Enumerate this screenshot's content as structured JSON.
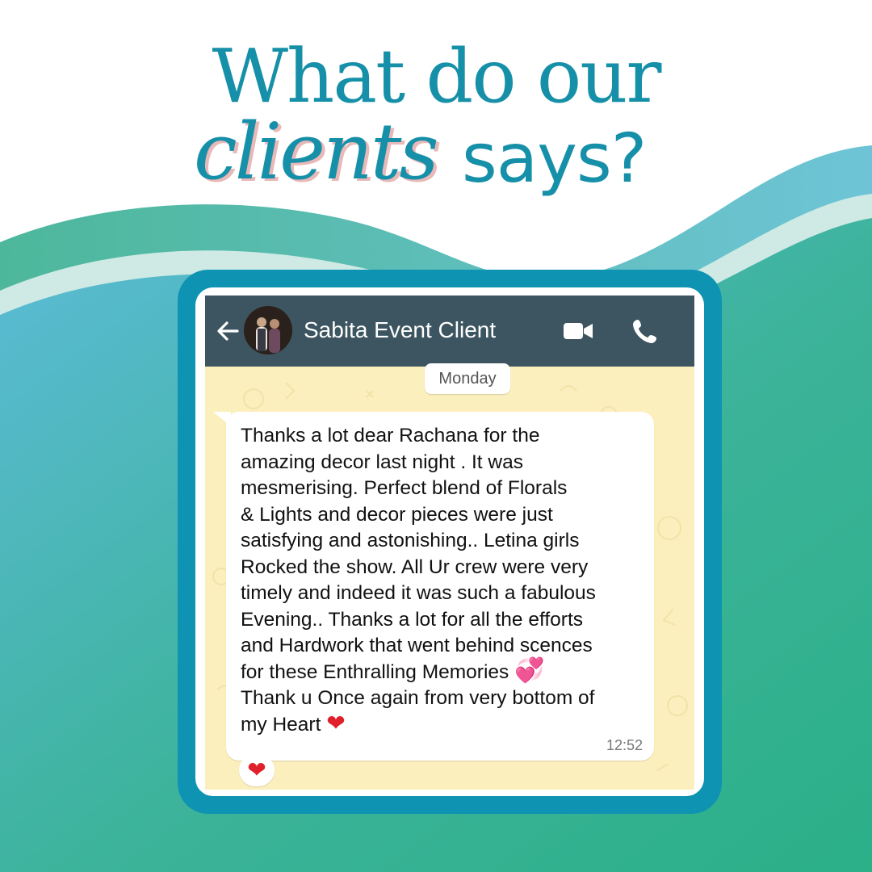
{
  "headline": {
    "line1": "What do our",
    "script_word": "clients",
    "line2_rest": "says?"
  },
  "chat": {
    "contact_name": "Sabita Event Client",
    "day_label": "Monday",
    "message": "Thanks a lot dear Rachana for the\namazing decor last night . It was\nmesmerising. Perfect blend of Florals\n& Lights and decor pieces were just\nsatisfying and astonishing.. Letina girls\nRocked the show. All Ur crew were very\ntimely and indeed it was such a fabulous\nEvening.. Thanks a lot for all the efforts\nand Hardwork that went behind scences\nfor these Enthralling Memories",
    "message_line2": "Thank u Once again from very bottom of\nmy Heart",
    "time": "12:52",
    "reaction": "❤"
  },
  "colors": {
    "brand_teal": "#1690a8",
    "frame": "#0f93b2",
    "header_bg": "#3d5560",
    "chat_bg": "#fbefbd",
    "wave_green": "#2bb088",
    "wave_blue": "#5dbbd8"
  },
  "icons": {
    "back": "arrow-left-icon",
    "video": "video-camera-icon",
    "call": "phone-icon",
    "inline_emoji_1": "two-hearts-icon",
    "inline_emoji_2": "red-heart-icon"
  }
}
